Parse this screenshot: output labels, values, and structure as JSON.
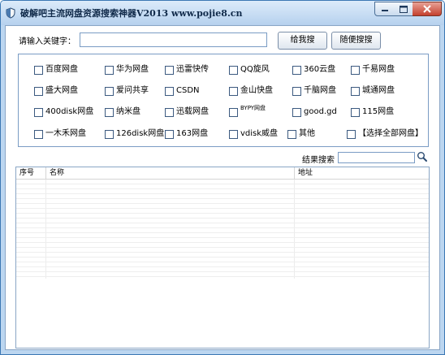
{
  "window": {
    "title": "破解吧主流网盘资源搜索神器V2013 www.pojie8.cn"
  },
  "search": {
    "label": "请输入关键字：",
    "value": "",
    "btn_search": "给我搜",
    "btn_random": "随便搜搜"
  },
  "providers": [
    "百度网盘",
    "华为网盘",
    "迅雷快传",
    "QQ旋风",
    "360云盘",
    "千易网盘",
    "盛大网盘",
    "爱问共享",
    "CSDN",
    "金山快盘",
    "千脑网盘",
    "城通网盘",
    "400disk网盘",
    "纳米盘",
    "迅载网盘",
    "BYPY网盘",
    "good.gd",
    "115网盘",
    "一木禾网盘",
    "126disk网盘",
    "163网盘",
    "vdisk威盘",
    "其他",
    "【选择全部网盘】"
  ],
  "results": {
    "label": "结果搜索",
    "value": ""
  },
  "table": {
    "columns": [
      "序号",
      "名称",
      "地址"
    ],
    "rows": []
  },
  "icons": {
    "app": "shield-icon",
    "search": "magnifier-icon",
    "minimize": "minimize-icon",
    "maximize": "maximize-icon",
    "close": "close-icon"
  },
  "colors": {
    "titlebar": "#c9def5",
    "frame": "#bcd6f0",
    "close": "#c4402e"
  }
}
